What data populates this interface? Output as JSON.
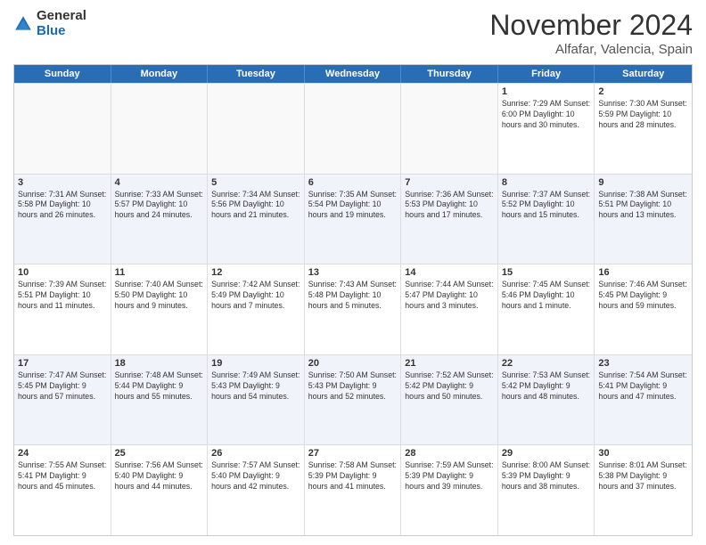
{
  "header": {
    "logo_line1": "General",
    "logo_line2": "Blue",
    "month": "November 2024",
    "location": "Alfafar, Valencia, Spain"
  },
  "weekdays": [
    "Sunday",
    "Monday",
    "Tuesday",
    "Wednesday",
    "Thursday",
    "Friday",
    "Saturday"
  ],
  "rows": [
    [
      {
        "day": "",
        "info": ""
      },
      {
        "day": "",
        "info": ""
      },
      {
        "day": "",
        "info": ""
      },
      {
        "day": "",
        "info": ""
      },
      {
        "day": "",
        "info": ""
      },
      {
        "day": "1",
        "info": "Sunrise: 7:29 AM\nSunset: 6:00 PM\nDaylight: 10 hours\nand 30 minutes."
      },
      {
        "day": "2",
        "info": "Sunrise: 7:30 AM\nSunset: 5:59 PM\nDaylight: 10 hours\nand 28 minutes."
      }
    ],
    [
      {
        "day": "3",
        "info": "Sunrise: 7:31 AM\nSunset: 5:58 PM\nDaylight: 10 hours\nand 26 minutes."
      },
      {
        "day": "4",
        "info": "Sunrise: 7:33 AM\nSunset: 5:57 PM\nDaylight: 10 hours\nand 24 minutes."
      },
      {
        "day": "5",
        "info": "Sunrise: 7:34 AM\nSunset: 5:56 PM\nDaylight: 10 hours\nand 21 minutes."
      },
      {
        "day": "6",
        "info": "Sunrise: 7:35 AM\nSunset: 5:54 PM\nDaylight: 10 hours\nand 19 minutes."
      },
      {
        "day": "7",
        "info": "Sunrise: 7:36 AM\nSunset: 5:53 PM\nDaylight: 10 hours\nand 17 minutes."
      },
      {
        "day": "8",
        "info": "Sunrise: 7:37 AM\nSunset: 5:52 PM\nDaylight: 10 hours\nand 15 minutes."
      },
      {
        "day": "9",
        "info": "Sunrise: 7:38 AM\nSunset: 5:51 PM\nDaylight: 10 hours\nand 13 minutes."
      }
    ],
    [
      {
        "day": "10",
        "info": "Sunrise: 7:39 AM\nSunset: 5:51 PM\nDaylight: 10 hours\nand 11 minutes."
      },
      {
        "day": "11",
        "info": "Sunrise: 7:40 AM\nSunset: 5:50 PM\nDaylight: 10 hours\nand 9 minutes."
      },
      {
        "day": "12",
        "info": "Sunrise: 7:42 AM\nSunset: 5:49 PM\nDaylight: 10 hours\nand 7 minutes."
      },
      {
        "day": "13",
        "info": "Sunrise: 7:43 AM\nSunset: 5:48 PM\nDaylight: 10 hours\nand 5 minutes."
      },
      {
        "day": "14",
        "info": "Sunrise: 7:44 AM\nSunset: 5:47 PM\nDaylight: 10 hours\nand 3 minutes."
      },
      {
        "day": "15",
        "info": "Sunrise: 7:45 AM\nSunset: 5:46 PM\nDaylight: 10 hours\nand 1 minute."
      },
      {
        "day": "16",
        "info": "Sunrise: 7:46 AM\nSunset: 5:45 PM\nDaylight: 9 hours\nand 59 minutes."
      }
    ],
    [
      {
        "day": "17",
        "info": "Sunrise: 7:47 AM\nSunset: 5:45 PM\nDaylight: 9 hours\nand 57 minutes."
      },
      {
        "day": "18",
        "info": "Sunrise: 7:48 AM\nSunset: 5:44 PM\nDaylight: 9 hours\nand 55 minutes."
      },
      {
        "day": "19",
        "info": "Sunrise: 7:49 AM\nSunset: 5:43 PM\nDaylight: 9 hours\nand 54 minutes."
      },
      {
        "day": "20",
        "info": "Sunrise: 7:50 AM\nSunset: 5:43 PM\nDaylight: 9 hours\nand 52 minutes."
      },
      {
        "day": "21",
        "info": "Sunrise: 7:52 AM\nSunset: 5:42 PM\nDaylight: 9 hours\nand 50 minutes."
      },
      {
        "day": "22",
        "info": "Sunrise: 7:53 AM\nSunset: 5:42 PM\nDaylight: 9 hours\nand 48 minutes."
      },
      {
        "day": "23",
        "info": "Sunrise: 7:54 AM\nSunset: 5:41 PM\nDaylight: 9 hours\nand 47 minutes."
      }
    ],
    [
      {
        "day": "24",
        "info": "Sunrise: 7:55 AM\nSunset: 5:41 PM\nDaylight: 9 hours\nand 45 minutes."
      },
      {
        "day": "25",
        "info": "Sunrise: 7:56 AM\nSunset: 5:40 PM\nDaylight: 9 hours\nand 44 minutes."
      },
      {
        "day": "26",
        "info": "Sunrise: 7:57 AM\nSunset: 5:40 PM\nDaylight: 9 hours\nand 42 minutes."
      },
      {
        "day": "27",
        "info": "Sunrise: 7:58 AM\nSunset: 5:39 PM\nDaylight: 9 hours\nand 41 minutes."
      },
      {
        "day": "28",
        "info": "Sunrise: 7:59 AM\nSunset: 5:39 PM\nDaylight: 9 hours\nand 39 minutes."
      },
      {
        "day": "29",
        "info": "Sunrise: 8:00 AM\nSunset: 5:39 PM\nDaylight: 9 hours\nand 38 minutes."
      },
      {
        "day": "30",
        "info": "Sunrise: 8:01 AM\nSunset: 5:38 PM\nDaylight: 9 hours\nand 37 minutes."
      }
    ]
  ]
}
